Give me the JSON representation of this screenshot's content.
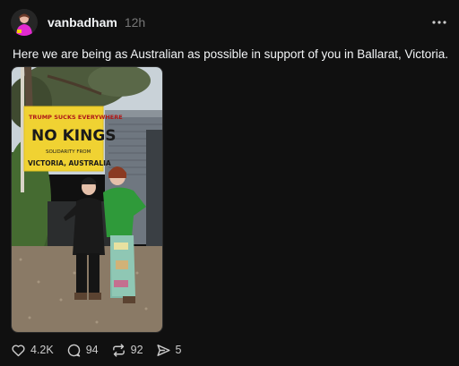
{
  "post": {
    "username": "vanbadham",
    "time": "12h",
    "caption": "Here we are being as Australian as possible in support of you in Ballarat, Victoria."
  },
  "sign": {
    "line1": "TRUMP SUCKS EVERYWHERE",
    "line2": "NO KINGS",
    "line3": "SOLIDARITY FROM",
    "line4": "VICTORIA, AUSTRALIA"
  },
  "actions": {
    "likes": "4.2K",
    "replies": "94",
    "reposts": "92",
    "shares": "5"
  },
  "colors": {
    "background": "#101010",
    "text": "#f3f5f7",
    "muted": "#777777",
    "sign_yellow": "#f0d232"
  }
}
